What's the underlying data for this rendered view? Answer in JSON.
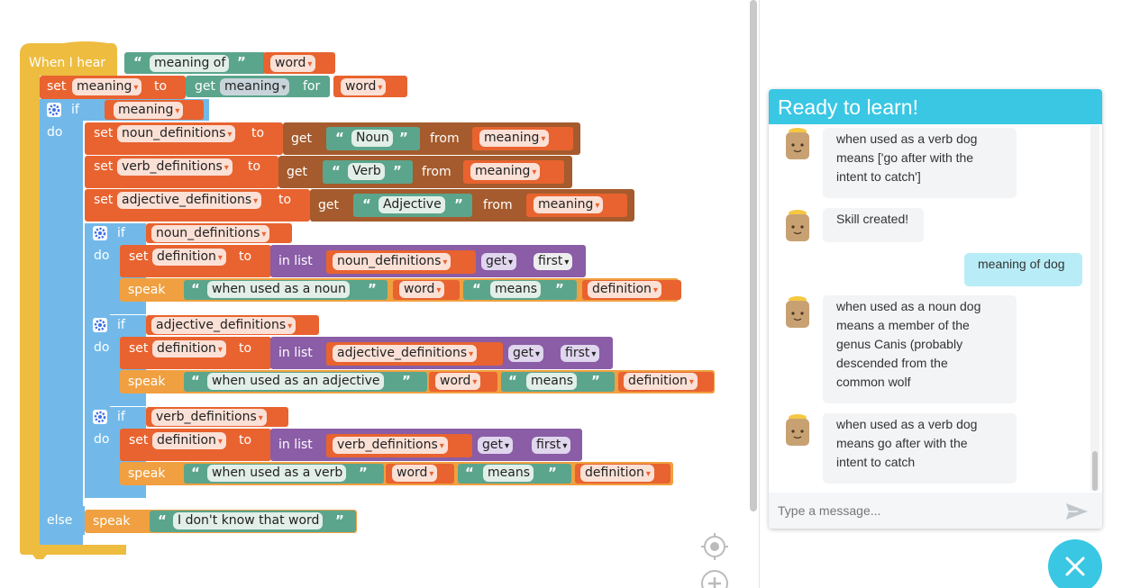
{
  "colors": {
    "event": "#eebc3f",
    "control": "#72b9e9",
    "variable": "#e8632f",
    "speak": "#f0a040",
    "text": "#5ba58c",
    "dictionary": "#a55b2d",
    "list": "#8a5da6",
    "chat_header": "#39c7e4",
    "user_bubble": "#b8edf7"
  },
  "blocks": {
    "when_i_hear": "When I hear",
    "hear_phrase": "meaning of",
    "hear_var": "word",
    "set1": {
      "set": "set",
      "var": "meaning",
      "to": "to",
      "get": "get",
      "dict": "meaning",
      "for": "for",
      "key": "word"
    },
    "if_main": {
      "if": "if",
      "do": "do",
      "else": "else",
      "cond": "meaning"
    },
    "set_noun": {
      "set": "set",
      "var": "noun_definitions",
      "to": "to",
      "get": "get",
      "key": "Noun",
      "from": "from",
      "dict": "meaning"
    },
    "set_verb": {
      "set": "set",
      "var": "verb_definitions",
      "to": "to",
      "get": "get",
      "key": "Verb",
      "from": "from",
      "dict": "meaning"
    },
    "set_adj": {
      "set": "set",
      "var": "adjective_definitions",
      "to": "to",
      "get": "get",
      "key": "Adjective",
      "from": "from",
      "dict": "meaning"
    },
    "if_noun": {
      "if": "if",
      "do": "do",
      "cond": "noun_definitions",
      "set": "set",
      "var": "definition",
      "to": "to",
      "in_list": "in list",
      "list": "noun_definitions",
      "get": "get",
      "first": "first",
      "speak": "speak",
      "phrase": "when used as a noun",
      "word": "word",
      "means": "means",
      "def": "definition"
    },
    "if_adj": {
      "if": "if",
      "do": "do",
      "cond": "adjective_definitions",
      "set": "set",
      "var": "definition",
      "to": "to",
      "in_list": "in list",
      "list": "adjective_definitions",
      "get": "get",
      "first": "first",
      "speak": "speak",
      "phrase": "when used as an adjective",
      "word": "word",
      "means": "means",
      "def": "definition"
    },
    "if_verb": {
      "if": "if",
      "do": "do",
      "cond": "verb_definitions",
      "set": "set",
      "var": "definition",
      "to": "to",
      "in_list": "in list",
      "list": "verb_definitions",
      "get": "get",
      "first": "first",
      "speak": "speak",
      "phrase": "when used as a verb",
      "word": "word",
      "means": "means",
      "def": "definition"
    },
    "else_speak": {
      "speak": "speak",
      "phrase": "I don't know that word"
    }
  },
  "chat": {
    "title": "Ready to learn!",
    "messages": [
      {
        "from": "bot",
        "lines": [
          "when used as a verb dog",
          "means ['go after with the",
          "intent to catch']"
        ]
      },
      {
        "from": "bot",
        "lines": [
          "Skill created!"
        ]
      },
      {
        "from": "user",
        "lines": [
          "meaning of dog"
        ]
      },
      {
        "from": "bot",
        "lines": [
          "when used as a noun dog",
          "means a member of the",
          "genus Canis (probably",
          "descended from the",
          "common wolf"
        ]
      },
      {
        "from": "bot",
        "lines": [
          "when used as a verb dog",
          "means go after with the",
          "intent to catch"
        ]
      }
    ],
    "input_placeholder": "Type a message..."
  },
  "icons": {
    "gear": "gear-icon",
    "send": "send-icon",
    "close": "close-icon",
    "recenter": "recenter-icon",
    "zoom_in": "zoom-in-icon",
    "avatar": "bot-avatar-icon"
  }
}
